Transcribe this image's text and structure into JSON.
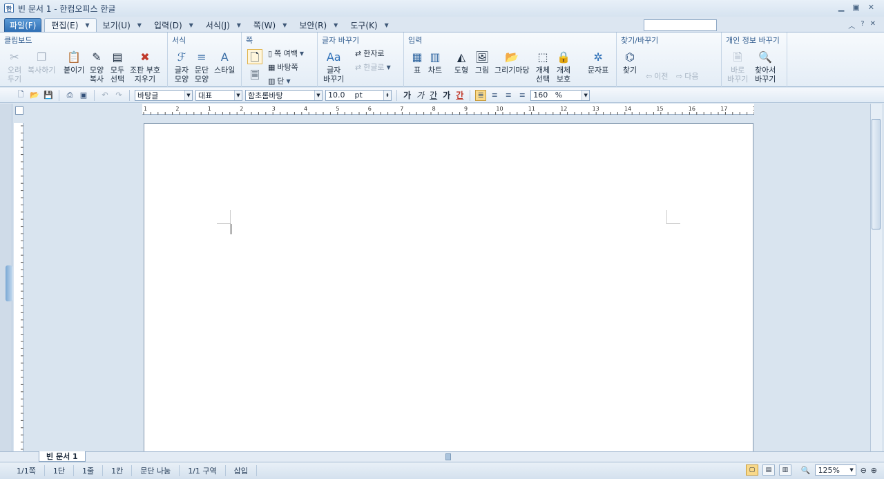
{
  "window": {
    "title": "빈 문서 1 - 한컴오피스 한글",
    "app_icon": "한"
  },
  "menu": {
    "file": "파일(F)",
    "tabs": [
      "편집(E)",
      "보기(U)",
      "입력(D)",
      "서식(J)",
      "쪽(W)",
      "보안(R)",
      "도구(K)"
    ],
    "help": "?"
  },
  "ribbon": {
    "clipboard": {
      "title": "클립보드",
      "cut": "오려\n두기",
      "copy": "복사하기",
      "paste": "붙이기",
      "format_copy": "모양\n복사",
      "select_all": "모두\n선택",
      "clear": "조판 부호\n지우기"
    },
    "format": {
      "title": "서식",
      "char_shape": "글자\n모양",
      "para_shape": "문단\n모양",
      "style": "스타일"
    },
    "page": {
      "title": "쪽",
      "margin": "쪽 여백",
      "background": "바탕쪽",
      "columns": "단"
    },
    "replace": {
      "title": "글자 바꾸기",
      "char_replace": "글자\n바꾸기",
      "to_hanja": "한자로",
      "to_hangul": "한글로"
    },
    "insert": {
      "title": "입력",
      "table": "표",
      "chart": "차트",
      "shape": "도형",
      "picture": "그림",
      "drawing_wizard": "그리기마당",
      "object_select": "개체\n선택",
      "object_protect": "개체\n보호",
      "char_map": "문자표"
    },
    "find": {
      "title": "찾기/바꾸기",
      "find": "찾기",
      "prev": "이전",
      "next": "다음"
    },
    "privacy": {
      "title": "개인 정보 바꾸기",
      "change": "바로\n바꾸기",
      "find_change": "찾아서\n바꾸기"
    }
  },
  "toolbar": {
    "style": "바탕글",
    "lang": "대표",
    "font": "함초롬바탕",
    "size": "10.0",
    "unit": "pt",
    "bold": "가",
    "italic": "가",
    "underline": "간",
    "strike": "가",
    "color": "간",
    "line_spacing": "160",
    "percent": "%"
  },
  "ruler": {
    "h_labels": [
      "1",
      "2",
      "1",
      "2",
      "3",
      "4",
      "5",
      "6",
      "7",
      "8",
      "9",
      "10",
      "11",
      "12",
      "13",
      "14",
      "15",
      "16",
      "17",
      "18"
    ]
  },
  "document": {
    "tab_label": "빈 문서 1"
  },
  "status": {
    "page": "1/1쪽",
    "column": "1단",
    "line": "1줄",
    "char": "1칸",
    "para": "문단 나눔",
    "section": "1/1 구역",
    "mode": "삽입",
    "zoom": "125%"
  }
}
